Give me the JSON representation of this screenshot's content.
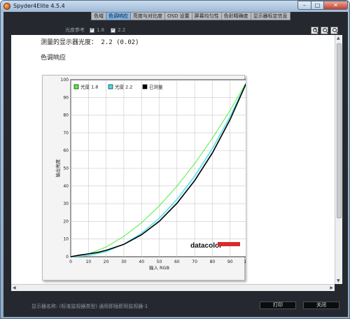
{
  "window": {
    "title": "Spyder4Elite 4.5.4",
    "controls": {
      "minimize": "–",
      "maximize": "□",
      "close": "✕"
    }
  },
  "tabs": [
    {
      "label": "色域",
      "active": false
    },
    {
      "label": "色调响应",
      "active": true
    },
    {
      "label": "亮度与对比度",
      "active": false
    },
    {
      "label": "OSD 设置",
      "active": false
    },
    {
      "label": "屏幕均匀性",
      "active": false
    },
    {
      "label": "色彩精确度",
      "active": false
    },
    {
      "label": "显示器标定信息",
      "active": false
    }
  ],
  "toolbar": {
    "legend_label": "光度参考",
    "option_1": "1.8",
    "option_2": "2.2",
    "zoom_buttons": [
      "zoom-in-icon",
      "zoom-out-icon",
      "zoom-fit-icon"
    ]
  },
  "report": {
    "gamma_text": "测量的显示器光度： 2.2 (0.02)",
    "section_title": "色调响应"
  },
  "chart_data": {
    "type": "line",
    "xlabel": "输入 RGB",
    "ylabel": "输出亮度",
    "xlim": [
      0,
      100
    ],
    "ylim": [
      0,
      100
    ],
    "xticks": [
      0,
      10,
      20,
      30,
      40,
      50,
      60,
      70,
      80,
      90,
      100
    ],
    "yticks": [
      0,
      10,
      20,
      30,
      40,
      50,
      60,
      70,
      80,
      90,
      100
    ],
    "grid": true,
    "legend_position": "top-left",
    "watermark": "datacolor",
    "series": [
      {
        "name": "光度 1.8",
        "color": "#54ee3e",
        "x": [
          0,
          10,
          20,
          30,
          40,
          50,
          60,
          70,
          80,
          90,
          100
        ],
        "y": [
          0,
          1.6,
          5.5,
          11.5,
          19.2,
          28.7,
          39.9,
          52.6,
          66.9,
          82.7,
          100
        ]
      },
      {
        "name": "光度 2.2",
        "color": "#3fe0e8",
        "x": [
          0,
          10,
          20,
          30,
          40,
          50,
          60,
          70,
          80,
          90,
          100
        ],
        "y": [
          0,
          0.6,
          2.9,
          7.1,
          13.3,
          21.8,
          32.5,
          45.6,
          61.2,
          79.3,
          100
        ]
      },
      {
        "name": "已测量",
        "color": "#000000",
        "x": [
          0,
          5,
          10,
          15,
          20,
          30,
          40,
          50,
          60,
          70,
          80,
          90,
          100
        ],
        "y": [
          0,
          0.9,
          1.6,
          2.4,
          3.6,
          7.0,
          12.4,
          20.0,
          30.2,
          43.0,
          58.6,
          77.5,
          100
        ]
      }
    ]
  },
  "footer": {
    "info": "显示器名称: (标准监视器类型) 通用即插即用监视器-1",
    "print_label": "打印",
    "close_label": "关闭"
  }
}
